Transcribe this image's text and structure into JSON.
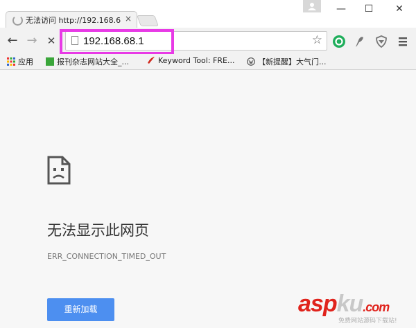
{
  "tab": {
    "title": "无法访问 http://192.168.6",
    "close": "×"
  },
  "window_controls": {
    "minimize": "—",
    "maximize": "☐",
    "close": "✕"
  },
  "toolbar": {
    "back": "←",
    "forward": "→",
    "stop": "✕",
    "url": "192.168.68.1",
    "star": "☆"
  },
  "bookmarks": {
    "items": [
      {
        "label": "应用",
        "icon": "apps-grid-icon"
      },
      {
        "label": "报刊杂志网站大全_...",
        "icon": "green-c-icon"
      },
      {
        "label": "Keyword Tool: FRE...",
        "icon": "red-swoosh-icon"
      },
      {
        "label": "【新提醒】大气门...",
        "icon": "wordpress-icon"
      }
    ]
  },
  "error": {
    "title": "无法显示此网页",
    "code": "ERR_CONNECTION_TIMED_OUT",
    "reload_label": "重新加载"
  },
  "watermark": {
    "brand_a": "asp",
    "brand_b": "ku",
    "brand_c": ".com",
    "tagline": "免费网站源码下载站!"
  },
  "colors": {
    "highlight": "#e83ae6",
    "reload_button": "#4d8ff0",
    "watermark": "#e0231c"
  }
}
